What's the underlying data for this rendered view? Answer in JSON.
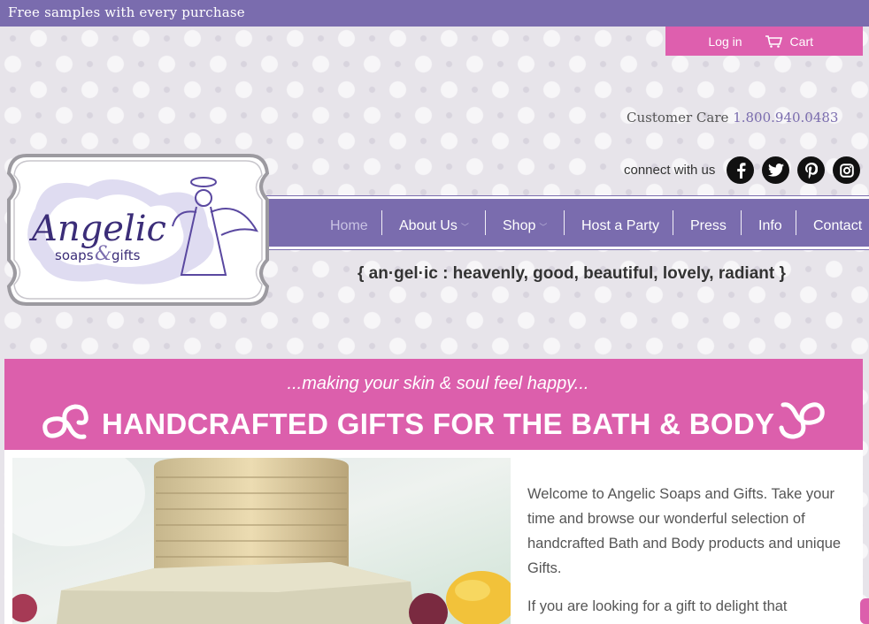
{
  "announcement": "Free samples with every purchase",
  "account": {
    "login_label": "Log in",
    "cart_label": "Cart"
  },
  "contact": {
    "care_label": "Customer Care",
    "phone": "1.800.940.0483"
  },
  "social": {
    "connect_label": "connect with us",
    "icons": [
      "facebook-icon",
      "twitter-icon",
      "pinterest-icon",
      "instagram-icon"
    ]
  },
  "logo": {
    "name": "Angelic",
    "subtitle_left": "soaps",
    "subtitle_right": "gifts"
  },
  "nav": {
    "items": [
      {
        "label": "Home",
        "active": true
      },
      {
        "label": "About Us",
        "dropdown": true
      },
      {
        "label": "Shop",
        "dropdown": true
      },
      {
        "label": "Host a Party"
      },
      {
        "label": "Press"
      },
      {
        "label": "Info"
      },
      {
        "label": "Contact"
      }
    ]
  },
  "tagline": "{ an·gel·ic : heavenly, good, beautiful, lovely, radiant }",
  "banner": {
    "slogan": "...making your skin & soul feel happy...",
    "headline": "HANDCRAFTED GIFTS FOR THE BATH & BODY"
  },
  "welcome": {
    "p1": "Welcome to Angelic Soaps and Gifts. Take your time and browse our wonderful selection of handcrafted Bath and Body products and unique Gifts.",
    "p2": "If you are looking for a gift to delight that"
  },
  "colors": {
    "brand_purple": "#7a6cae",
    "brand_pink": "#dc5fac"
  }
}
